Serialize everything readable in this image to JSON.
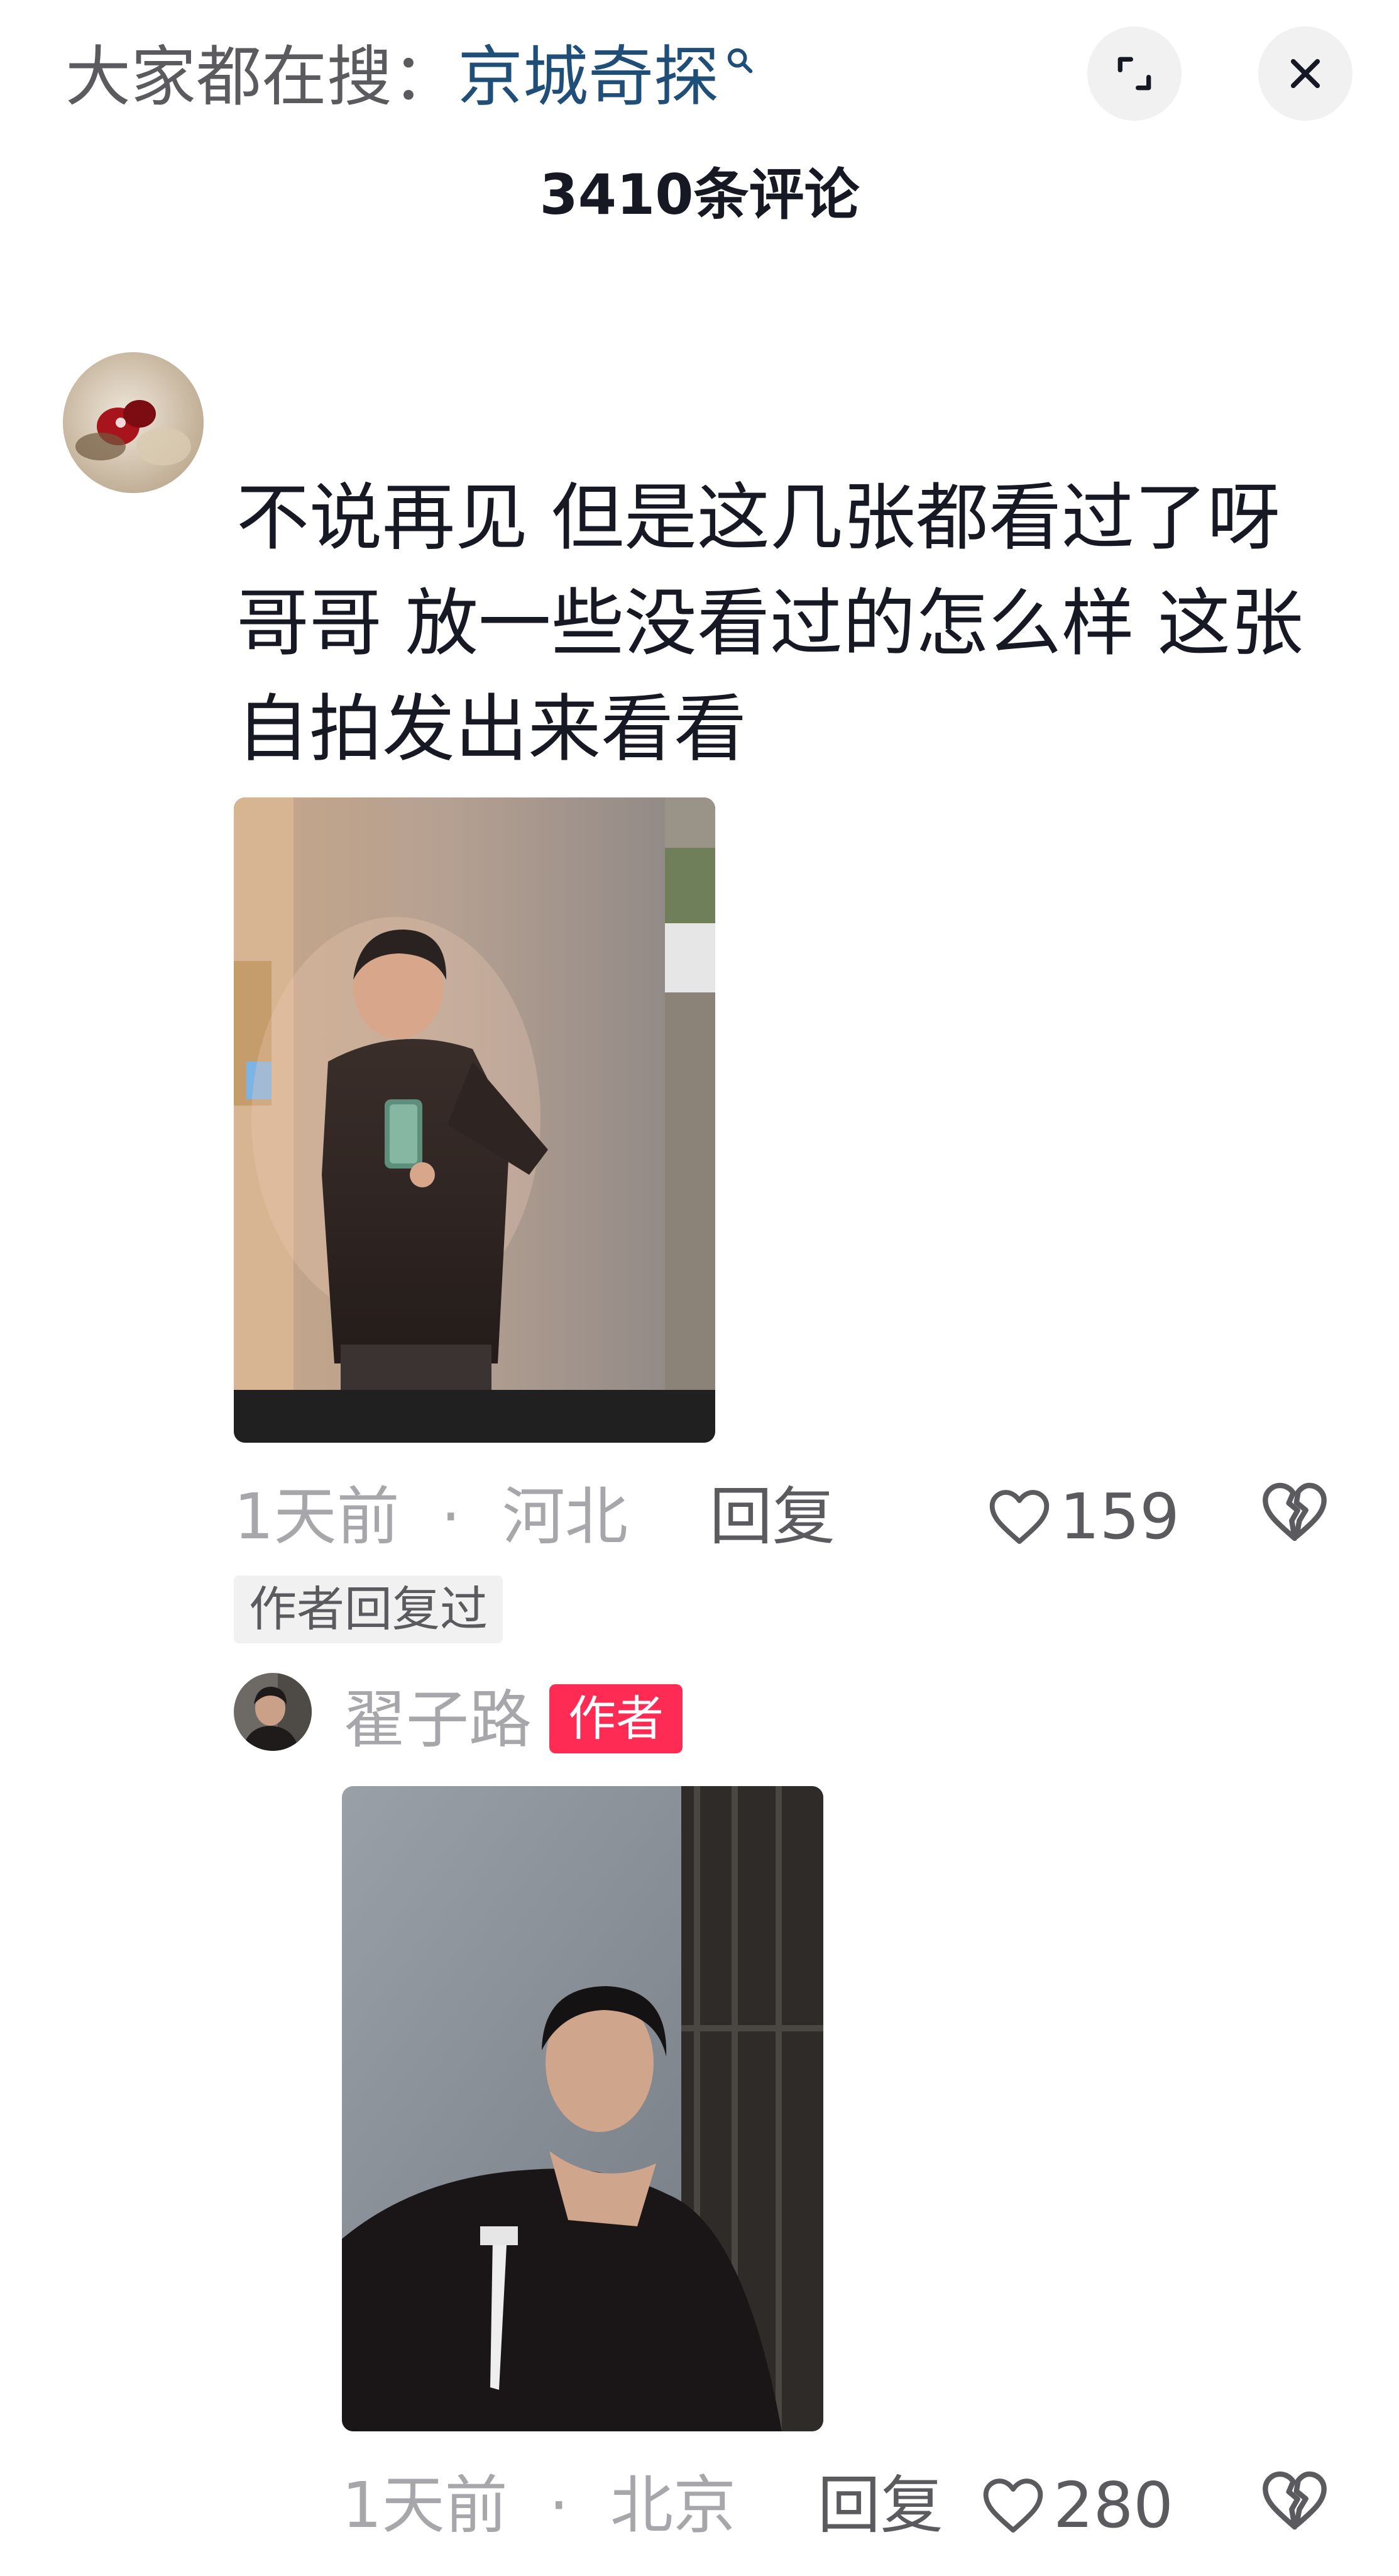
{
  "header": {
    "hot_search_prefix": "大家都在搜：",
    "hot_search_keyword": "京城奇探",
    "comment_count": "3410条评论"
  },
  "comment": {
    "text_lines": [
      "不说再见 但是这几张都看过了呀",
      "哥哥 放一些没看过的怎么样 这张",
      "自拍发出来看看"
    ],
    "time": "1天前",
    "dot": "·",
    "location": "河北",
    "reply_label": "回复",
    "likes": "159",
    "author_replied_tag": "作者回复过"
  },
  "reply": {
    "username": "翟子路",
    "author_badge": "作者",
    "time": "1天前",
    "dot": "·",
    "location": "北京",
    "reply_label": "回复",
    "likes": "280"
  },
  "icons": {
    "search": "search-icon",
    "expand": "expand-icon",
    "close": "close-icon",
    "heart": "heart-icon",
    "dislike": "broken-heart-icon"
  },
  "colors": {
    "keyword": "#1f4e79",
    "author_badge_bg": "#fe2c55",
    "muted_text": "#a7a7ab"
  }
}
